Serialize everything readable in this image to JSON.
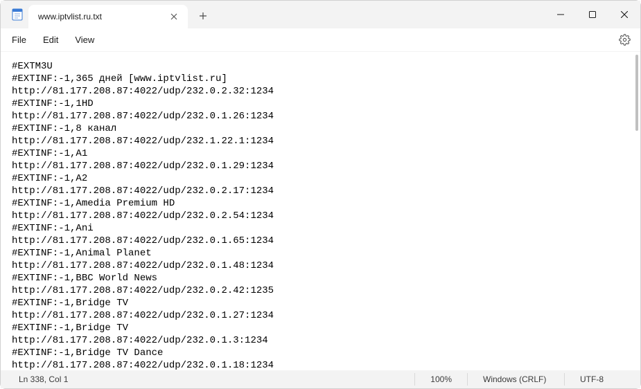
{
  "titlebar": {
    "tab_title": "www.iptvlist.ru.txt"
  },
  "menu": {
    "file": "File",
    "edit": "Edit",
    "view": "View"
  },
  "content_lines": [
    "#EXTM3U",
    "#EXTINF:-1,365 дней [www.iptvlist.ru]",
    "http://81.177.208.87:4022/udp/232.0.2.32:1234",
    "#EXTINF:-1,1HD",
    "http://81.177.208.87:4022/udp/232.0.1.26:1234",
    "#EXTINF:-1,8 канал",
    "http://81.177.208.87:4022/udp/232.1.22.1:1234",
    "#EXTINF:-1,A1",
    "http://81.177.208.87:4022/udp/232.0.1.29:1234",
    "#EXTINF:-1,A2",
    "http://81.177.208.87:4022/udp/232.0.2.17:1234",
    "#EXTINF:-1,Amedia Premium HD",
    "http://81.177.208.87:4022/udp/232.0.2.54:1234",
    "#EXTINF:-1,Ani",
    "http://81.177.208.87:4022/udp/232.0.1.65:1234",
    "#EXTINF:-1,Animal Planet",
    "http://81.177.208.87:4022/udp/232.0.1.48:1234",
    "#EXTINF:-1,BBC World News",
    "http://81.177.208.87:4022/udp/232.0.2.42:1235",
    "#EXTINF:-1,Bridge TV",
    "http://81.177.208.87:4022/udp/232.0.1.27:1234",
    "#EXTINF:-1,Bridge TV",
    "http://81.177.208.87:4022/udp/232.0.1.3:1234",
    "#EXTINF:-1,Bridge TV Dance",
    "http://81.177.208.87:4022/udp/232.0.1.18:1234"
  ],
  "statusbar": {
    "position": "Ln 338, Col 1",
    "zoom": "100%",
    "line_ending": "Windows (CRLF)",
    "encoding": "UTF-8"
  }
}
